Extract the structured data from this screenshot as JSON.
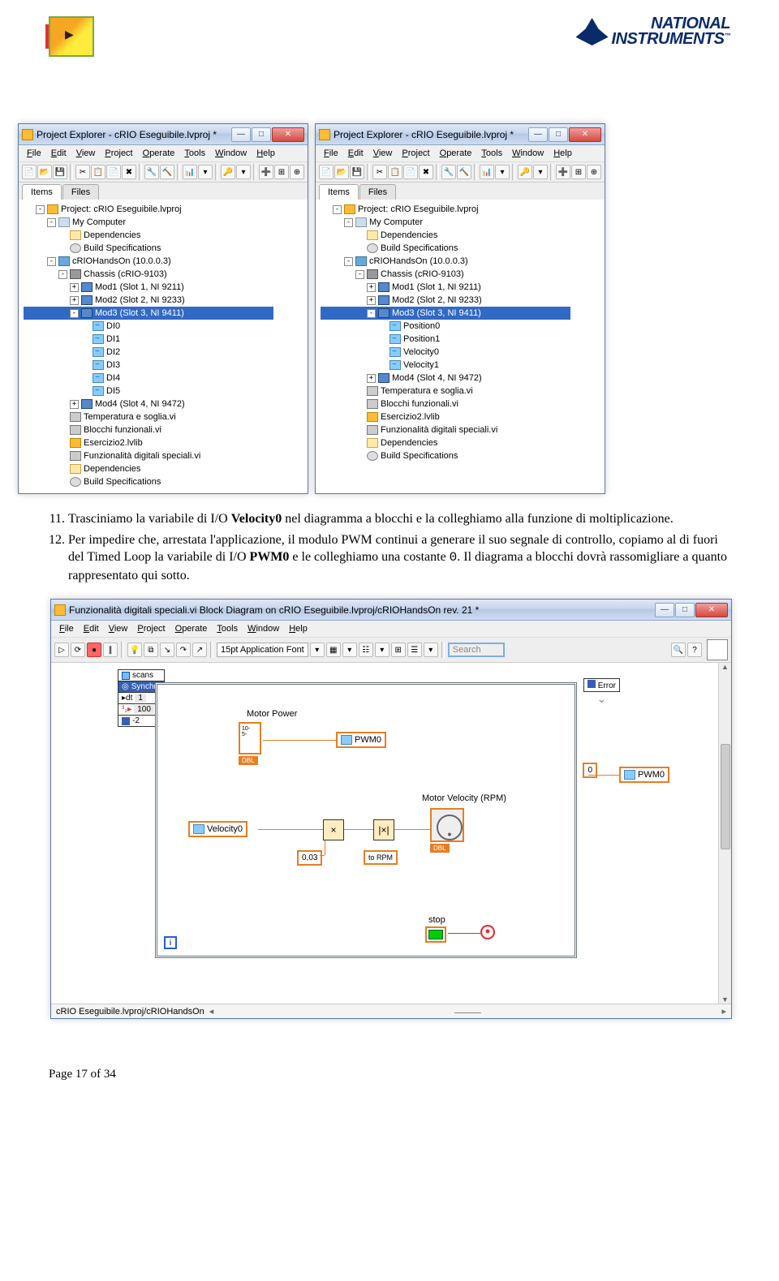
{
  "header": {
    "ni_top": "NATIONAL",
    "ni_bottom": "INSTRUMENTS",
    "tm": "™"
  },
  "paneL": {
    "title": "Project Explorer - cRIO Eseguibile.lvproj *",
    "menu": [
      "File",
      "Edit",
      "View",
      "Project",
      "Operate",
      "Tools",
      "Window",
      "Help"
    ],
    "tabs": [
      "Items",
      "Files"
    ],
    "tree": [
      {
        "d": 0,
        "e": "-",
        "i": "proj",
        "t": "Project: cRIO Eseguibile.lvproj"
      },
      {
        "d": 1,
        "e": "-",
        "i": "pc",
        "t": "My Computer"
      },
      {
        "d": 2,
        "e": "",
        "i": "folder",
        "t": "Dependencies"
      },
      {
        "d": 2,
        "e": "",
        "i": "gear",
        "t": "Build Specifications"
      },
      {
        "d": 1,
        "e": "-",
        "i": "target",
        "t": "cRIOHandsOn (10.0.0.3)"
      },
      {
        "d": 2,
        "e": "-",
        "i": "chassis",
        "t": "Chassis (cRIO-9103)"
      },
      {
        "d": 3,
        "e": "+",
        "i": "mod",
        "t": "Mod1 (Slot 1, NI 9211)"
      },
      {
        "d": 3,
        "e": "+",
        "i": "mod",
        "t": "Mod2 (Slot 2, NI 9233)"
      },
      {
        "d": 3,
        "e": "-",
        "i": "mod",
        "t": "Mod3 (Slot 3, NI 9411)",
        "sel": true
      },
      {
        "d": 4,
        "e": "",
        "i": "io",
        "t": "DI0"
      },
      {
        "d": 4,
        "e": "",
        "i": "io",
        "t": "DI1"
      },
      {
        "d": 4,
        "e": "",
        "i": "io",
        "t": "DI2"
      },
      {
        "d": 4,
        "e": "",
        "i": "io",
        "t": "DI3"
      },
      {
        "d": 4,
        "e": "",
        "i": "io",
        "t": "DI4"
      },
      {
        "d": 4,
        "e": "",
        "i": "io",
        "t": "DI5"
      },
      {
        "d": 3,
        "e": "+",
        "i": "mod",
        "t": "Mod4 (Slot 4, NI 9472)"
      },
      {
        "d": 2,
        "e": "",
        "i": "vi",
        "t": "Temperatura e soglia.vi"
      },
      {
        "d": 2,
        "e": "",
        "i": "vi",
        "t": "Blocchi funzionali.vi"
      },
      {
        "d": 2,
        "e": "",
        "i": "llb",
        "t": "Esercizio2.lvlib"
      },
      {
        "d": 2,
        "e": "",
        "i": "vi",
        "t": "Funzionalità digitali speciali.vi"
      },
      {
        "d": 2,
        "e": "",
        "i": "folder",
        "t": "Dependencies"
      },
      {
        "d": 2,
        "e": "",
        "i": "gear",
        "t": "Build Specifications"
      }
    ]
  },
  "paneR": {
    "title": "Project Explorer - cRIO Eseguibile.lvproj *",
    "tree": [
      {
        "d": 0,
        "e": "-",
        "i": "proj",
        "t": "Project: cRIO Eseguibile.lvproj"
      },
      {
        "d": 1,
        "e": "-",
        "i": "pc",
        "t": "My Computer"
      },
      {
        "d": 2,
        "e": "",
        "i": "folder",
        "t": "Dependencies"
      },
      {
        "d": 2,
        "e": "",
        "i": "gear",
        "t": "Build Specifications"
      },
      {
        "d": 1,
        "e": "-",
        "i": "target",
        "t": "cRIOHandsOn (10.0.0.3)"
      },
      {
        "d": 2,
        "e": "-",
        "i": "chassis",
        "t": "Chassis (cRIO-9103)"
      },
      {
        "d": 3,
        "e": "+",
        "i": "mod",
        "t": "Mod1 (Slot 1, NI 9211)"
      },
      {
        "d": 3,
        "e": "+",
        "i": "mod",
        "t": "Mod2 (Slot 2, NI 9233)"
      },
      {
        "d": 3,
        "e": "-",
        "i": "mod",
        "t": "Mod3 (Slot 3, NI 9411)",
        "sel": true
      },
      {
        "d": 4,
        "e": "",
        "i": "io",
        "t": "Position0"
      },
      {
        "d": 4,
        "e": "",
        "i": "io",
        "t": "Position1"
      },
      {
        "d": 4,
        "e": "",
        "i": "io",
        "t": "Velocity0"
      },
      {
        "d": 4,
        "e": "",
        "i": "io",
        "t": "Velocity1"
      },
      {
        "d": 3,
        "e": "+",
        "i": "mod",
        "t": "Mod4 (Slot 4, NI 9472)"
      },
      {
        "d": 2,
        "e": "",
        "i": "vi",
        "t": "Temperatura e soglia.vi"
      },
      {
        "d": 2,
        "e": "",
        "i": "vi",
        "t": "Blocchi funzionali.vi"
      },
      {
        "d": 2,
        "e": "",
        "i": "llb",
        "t": "Esercizio2.lvlib"
      },
      {
        "d": 2,
        "e": "",
        "i": "vi",
        "t": "Funzionalità digitali speciali.vi"
      },
      {
        "d": 2,
        "e": "",
        "i": "folder",
        "t": "Dependencies"
      },
      {
        "d": 2,
        "e": "",
        "i": "gear",
        "t": "Build Specifications"
      }
    ]
  },
  "step11": {
    "num": "11.",
    "text_pre": "Trasciniamo la variabile di I/O ",
    "bold1": "Velocity0",
    "text_mid": " nel diagramma a blocchi e la colleghiamo alla funzione di moltiplicazione."
  },
  "step12": {
    "num": "12.",
    "text1": "Per impedire che, arrestata l'applicazione, il modulo PWM continui a generare il suo segnale di controllo, copiamo al di fuori del Timed Loop la variabile di I/O ",
    "bold1": "PWM0",
    "text2": " e le colleghiamo una costante ",
    "zero": "0",
    "text3": ". Il diagrama a blocchi dovrà rassomigliare a quanto rappresentato qui sotto."
  },
  "bd": {
    "title": "Funzionalità digitali speciali.vi Block Diagram on cRIO Eseguibile.lvproj/cRIOHandsOn rev. 21 *",
    "menu": [
      "File",
      "Edit",
      "View",
      "Project",
      "Operate",
      "Tools",
      "Window",
      "Help"
    ],
    "font": "15pt Application Font",
    "search_ph": "Search",
    "labels": {
      "scans": "scans",
      "synchro": "Synchro",
      "dt": "dt",
      "src": "100",
      "err_name": "-2",
      "error": "Error",
      "motor_power": "Motor Power",
      "pwm0": "PWM0",
      "pwm0b": "PWM0",
      "zero": "0",
      "velocity0": "Velocity0",
      "mult_c": "0,03",
      "to_rpm": "to RPM",
      "motor_vel": "Motor Velocity (RPM)",
      "stop": "stop",
      "iter": "i"
    },
    "status": "cRIO Eseguibile.lvproj/cRIOHandsOn"
  },
  "footer": "Page 17 of 34"
}
